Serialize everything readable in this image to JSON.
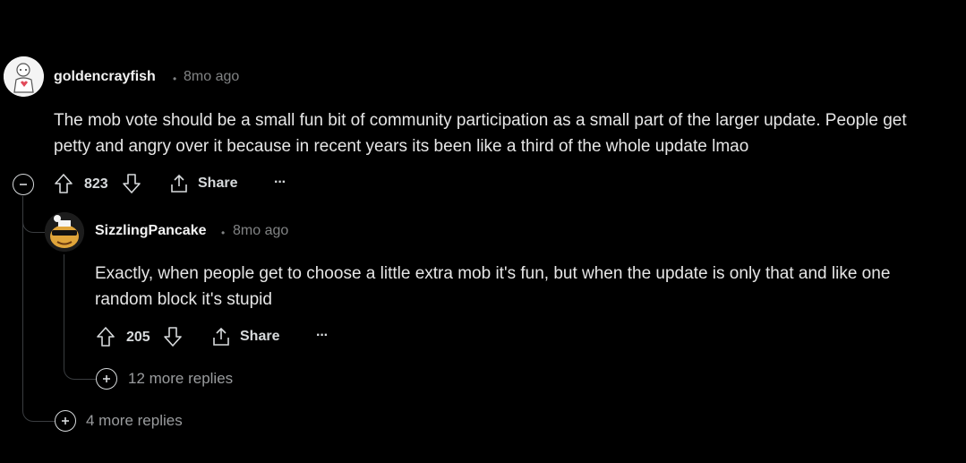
{
  "comment": {
    "username": "goldencrayfish",
    "dot": "•",
    "time": "8mo ago",
    "line1": "The mob vote should be a small fun bit of community participation as a small part of the larger update. People get",
    "line2": "petty and angry over it because in recent years its been like a third of the whole update lmao",
    "score": "823",
    "share_label": "Share",
    "more_label": "···"
  },
  "reply": {
    "username": "SizzlingPancake",
    "dot": "•",
    "time": "8mo ago",
    "line1": "Exactly, when people get to choose a little extra mob it's fun, but when the update is only that and like one",
    "line2": "random block it's stupid",
    "score": "205",
    "share_label": "Share",
    "more_label": "···",
    "more_replies": "12 more replies"
  },
  "thread": {
    "more_replies": "4 more replies"
  }
}
